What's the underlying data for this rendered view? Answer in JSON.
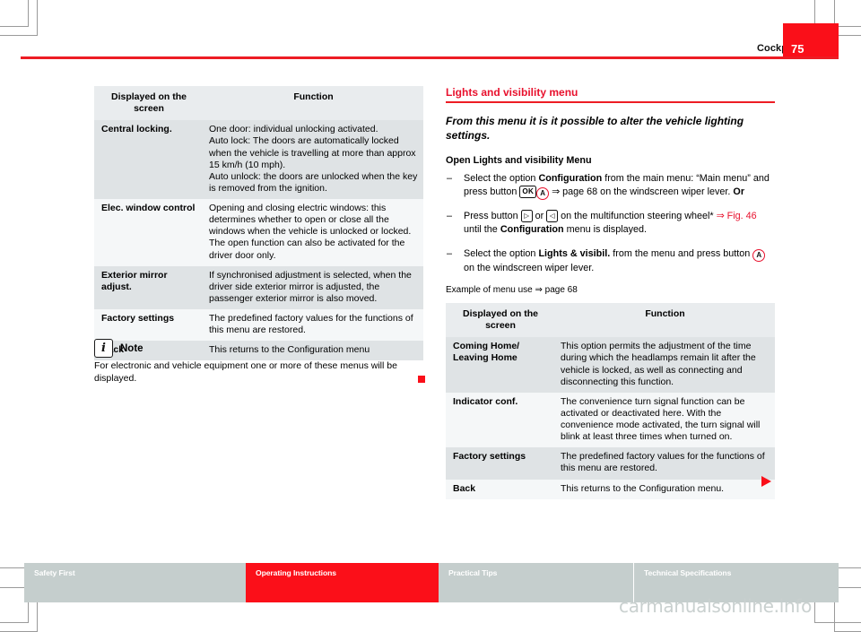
{
  "header": {
    "chapter": "Cockpit",
    "page_number": "75",
    "accent_color": "#ed1c24",
    "page_box_color": "#fa0f19"
  },
  "left_column": {
    "table": {
      "columns": [
        "Displayed on the screen",
        "Function"
      ],
      "column_header_line1": "Displayed on the",
      "column_header_line2": "screen",
      "rows": [
        {
          "label": "Central locking.",
          "function": "One door: individual unlocking activated.\nAuto lock: The doors are automatically locked when the vehicle is travelling at more than approx 15 km/h (10 mph).\nAuto unlock: the doors are unlocked when the key is removed from the ignition."
        },
        {
          "label": "Elec. window control",
          "function": "Opening and closing electric windows: this determines whether to open or close all the windows when the vehicle is unlocked or locked. The open function can also be activated for the driver door only."
        },
        {
          "label": "Exterior mirror adjust.",
          "function": "If synchronised adjustment is selected, when the driver side exterior mirror is adjusted, the passenger exterior mirror is also moved."
        },
        {
          "label": "Factory settings",
          "function": "The predefined factory values for the functions of this menu are restored."
        },
        {
          "label": "Back",
          "function": "This returns to the Configuration menu"
        }
      ]
    },
    "note": {
      "icon": "info-icon",
      "icon_glyph": "i",
      "title": "Note",
      "body": "For electronic and vehicle equipment one or more of these menus will be displayed.",
      "end_marker_color": "#fa0f19"
    }
  },
  "right_column": {
    "section_title": "Lights and visibility menu",
    "intro": "From this menu it is it possible to alter the vehicle lighting settings.",
    "sub_head": "Open Lights and visibility Menu",
    "bullets": [
      {
        "dash": "–",
        "part1": "Select the option ",
        "bold1": "Configuration",
        "part2": " from the main menu: “Main menu” and press button ",
        "key_ok": "OK",
        "key_a": "A",
        "part3": " ⇒ page 68 on the windscreen wiper lever. ",
        "bold2": "Or"
      },
      {
        "dash": "–",
        "part1": "Press button ",
        "key_right": "▷",
        "part2": " or ",
        "key_left": "◁",
        "part3": " on the multifunction steering wheel* ",
        "xref": "⇒ Fig. 46",
        "part4": " until the ",
        "bold1": "Configuration",
        "part5": " menu is displayed."
      },
      {
        "dash": "–",
        "part1": "Select the option ",
        "bold1": "Lights & visibil.",
        "part2": " from the menu and press button ",
        "key_a": "A",
        "part3": " on the windscreen wiper lever."
      }
    ],
    "example_line": "Example of menu use  ⇒ page 68",
    "table": {
      "columns": [
        "Displayed on the screen",
        "Function"
      ],
      "column_header_line1": "Displayed on the",
      "column_header_line2": "screen",
      "rows": [
        {
          "label": "Coming Home/\nLeaving Home",
          "function": "This option permits the adjustment of the time during which the headlamps remain lit after the vehicle is locked, as well as connecting and disconnecting this function."
        },
        {
          "label": "Indicator conf.",
          "function": "The convenience turn signal function can be activated or deactivated here. With the convenience mode activated, the turn signal will blink at least three times when turned on."
        },
        {
          "label": "Factory settings",
          "function": "The predefined factory values for the functions of this menu are restored."
        },
        {
          "label": "Back",
          "function": "This returns to the Configuration menu."
        }
      ]
    },
    "continue_marker": "▶"
  },
  "footer": {
    "segments": [
      {
        "label": "Safety First",
        "active": false
      },
      {
        "label": "Operating Instructions",
        "active": true
      },
      {
        "label": "Practical Tips",
        "active": false
      },
      {
        "label": "Technical Specifications",
        "active": false
      }
    ],
    "active_color": "#fb0f19",
    "inactive_color": "#c5cecd"
  },
  "watermark": "carmanualsonline.info"
}
